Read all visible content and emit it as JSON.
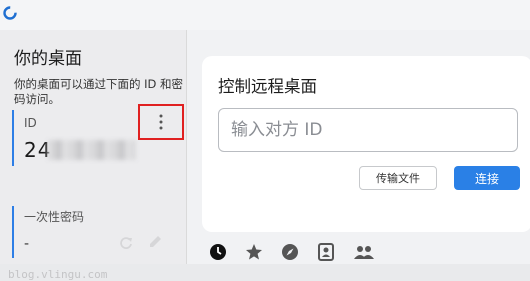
{
  "app": {
    "logo_icon": "rustdesk-logo-icon",
    "accent_color": "#2a80e6"
  },
  "left_panel": {
    "title": "你的桌面",
    "description": "你的桌面可以通过下面的 ID 和密码访问。",
    "id_label": "ID",
    "id_value_visible": "24",
    "more_icon": "more-vertical-icon",
    "otp_label": "一次性密码",
    "otp_value": "-",
    "refresh_icon": "refresh-icon",
    "edit_icon": "edit-icon",
    "watermark": "blog.vlingu.com"
  },
  "remote": {
    "title": "控制远程桌面",
    "input_placeholder": "输入对方 ID",
    "input_value": "",
    "transfer_button": "传输文件",
    "connect_button": "连接"
  },
  "bottom_icons": [
    "history-icon",
    "star-icon",
    "compass-icon",
    "address-book-icon",
    "group-icon"
  ]
}
